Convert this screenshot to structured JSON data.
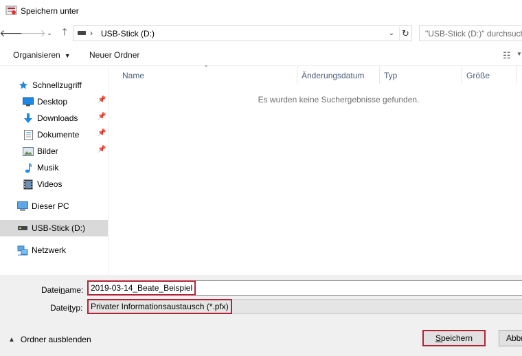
{
  "window": {
    "title": "Speichern unter"
  },
  "address": {
    "path": "USB-Stick (D:)",
    "search_placeholder": "\"USB-Stick (D:)\" durchsuchen"
  },
  "toolbar": {
    "organize": "Organisieren",
    "new_folder": "Neuer Ordner"
  },
  "sidebar": {
    "items": [
      {
        "label": "Schnellzugriff"
      },
      {
        "label": "Desktop"
      },
      {
        "label": "Downloads"
      },
      {
        "label": "Dokumente"
      },
      {
        "label": "Bilder"
      },
      {
        "label": "Musik"
      },
      {
        "label": "Videos"
      },
      {
        "label": "Dieser PC"
      },
      {
        "label": "USB-Stick (D:)"
      },
      {
        "label": "Netzwerk"
      }
    ]
  },
  "columns": [
    "Name",
    "Änderungsdatum",
    "Typ",
    "Größe"
  ],
  "empty_message": "Es wurden keine Suchergebnisse gefunden.",
  "form": {
    "filename_label_pre": "Datei",
    "filename_label_ul": "n",
    "filename_label_post": "ame:",
    "filename_value": "2019-03-14_Beate_Beispiel",
    "filetype_label_pre": "Datei",
    "filetype_label_ul": "t",
    "filetype_label_post": "yp:",
    "filetype_value": "Privater Informationsaustausch (*.pfx)"
  },
  "footer": {
    "hide_folders": "Ordner ausblenden",
    "save_ul": "S",
    "save_rest": "peichern",
    "cancel": "Abbrechen"
  },
  "colors": {
    "highlight": "#b22234",
    "selected": "#d9d9d9",
    "accent": "#0078d7"
  }
}
